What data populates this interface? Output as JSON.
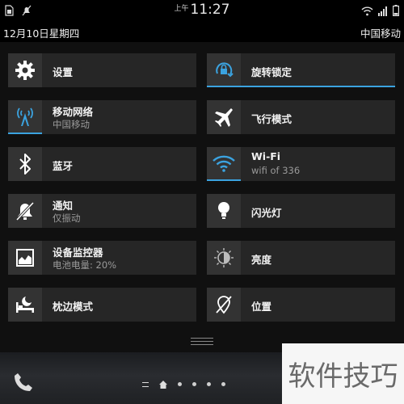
{
  "status_bar": {
    "ampm": "上午",
    "time": "11:27",
    "left_icons": [
      "sim-icon",
      "mute-icon"
    ],
    "right_icons": [
      "wifi-icon",
      "signal-icon",
      "battery-icon"
    ]
  },
  "info_bar": {
    "date": "12月10日星期四",
    "carrier": "中国移动"
  },
  "tiles": [
    {
      "key": "settings",
      "label": "设置",
      "sub": "",
      "icon": "gear-icon"
    },
    {
      "key": "rotation-lock",
      "label": "旋转锁定",
      "sub": "",
      "icon": "rotation-lock-icon"
    },
    {
      "key": "mobile-network",
      "label": "移动网络",
      "sub": "中国移动",
      "icon": "antenna-icon"
    },
    {
      "key": "airplane-mode",
      "label": "飞行模式",
      "sub": "",
      "icon": "airplane-icon"
    },
    {
      "key": "bluetooth",
      "label": "蓝牙",
      "sub": "",
      "icon": "bluetooth-icon"
    },
    {
      "key": "wifi",
      "label": "Wi-Fi",
      "sub": "wifi of 336",
      "icon": "wifi-icon"
    },
    {
      "key": "notifications",
      "label": "通知",
      "sub": "仅振动",
      "icon": "bell-off-icon"
    },
    {
      "key": "flashlight",
      "label": "闪光灯",
      "sub": "",
      "icon": "flashlight-icon"
    },
    {
      "key": "device-monitor",
      "label": "设备监控器",
      "sub": "电池电量:  20%",
      "icon": "monitor-chart-icon"
    },
    {
      "key": "brightness",
      "label": "亮度",
      "sub": "",
      "icon": "brightness-icon"
    },
    {
      "key": "bedside-mode",
      "label": "枕边模式",
      "sub": "",
      "icon": "bedside-icon"
    },
    {
      "key": "location",
      "label": "位置",
      "sub": "",
      "icon": "location-off-icon"
    }
  ],
  "colors": {
    "accent": "#3ba3e0",
    "tile": "#262626",
    "icon_box": "#333333"
  },
  "watermark": "软件技巧"
}
